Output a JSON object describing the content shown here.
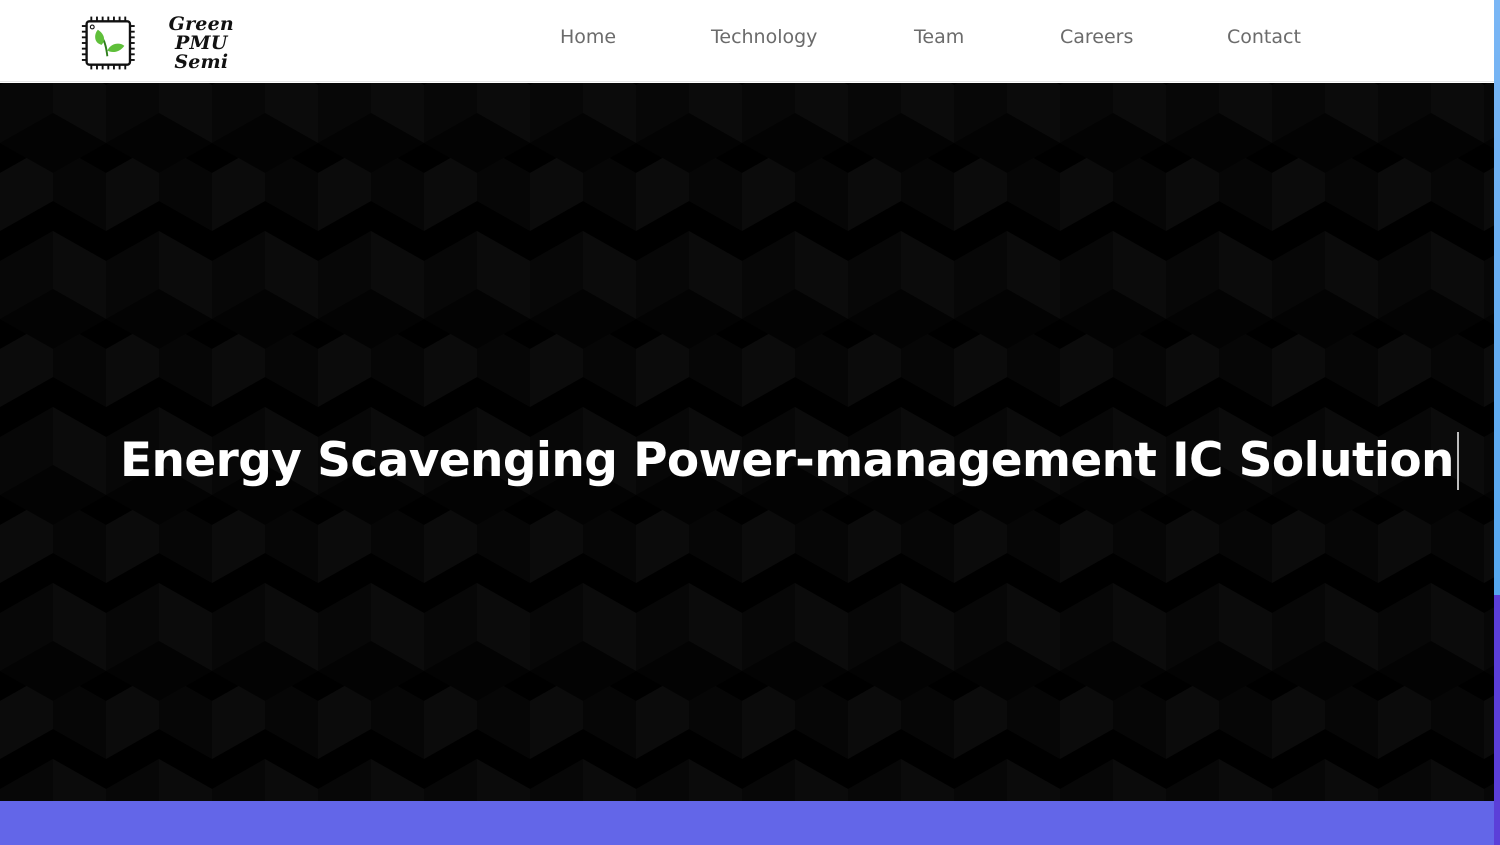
{
  "brand": {
    "line1": "Green PMU",
    "line2": "Semi",
    "icon": "chip-leaf-logo"
  },
  "nav": {
    "items": [
      {
        "label": "Home"
      },
      {
        "label": "Technology"
      },
      {
        "label": "Team"
      },
      {
        "label": "Careers"
      },
      {
        "label": "Contact"
      }
    ]
  },
  "hero": {
    "title": "Energy Scavenging Power-management IC Solution"
  },
  "colors": {
    "nav_background": "#ffffff",
    "nav_text": "#6b6b6b",
    "hero_background": "#000000",
    "hero_text": "#ffffff",
    "band": "#6366e8",
    "leaf_green": "#5fbf3a",
    "scrollbar_thumb": "#6ab0f3",
    "scrollbar_track": "#5b3fd8"
  }
}
